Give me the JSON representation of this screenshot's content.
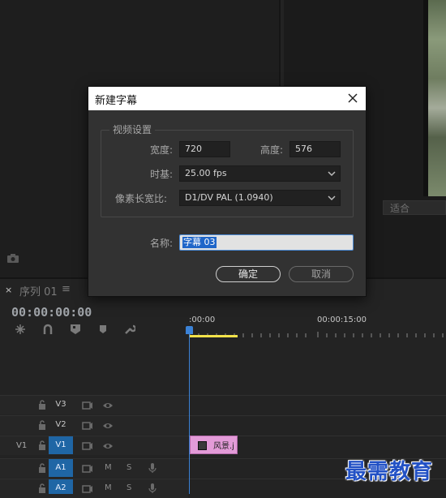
{
  "program_monitor": {
    "fit_select": "适合"
  },
  "sequence": {
    "tab_label": "序列 01",
    "close_glyph": "×",
    "menu_glyph": "≡",
    "timecode": "00:00:00:00"
  },
  "ruler": {
    "start": ":00:00",
    "mid": "00:00:15:00"
  },
  "tracks": [
    {
      "source": "",
      "name": "V3",
      "active": false,
      "type": "video"
    },
    {
      "source": "",
      "name": "V2",
      "active": false,
      "type": "video"
    },
    {
      "source": "V1",
      "name": "V1",
      "active": true,
      "type": "video"
    },
    {
      "source": "",
      "name": "A1",
      "active": true,
      "type": "audio",
      "m": "M",
      "s": "S"
    },
    {
      "source": "",
      "name": "A2",
      "active": true,
      "type": "audio",
      "m": "M",
      "s": "S"
    }
  ],
  "clip": {
    "label": "风景.j"
  },
  "watermark": "最需教育",
  "dialog": {
    "title": "新建字幕",
    "group_title": "视频设置",
    "width_label": "宽度:",
    "width_value": "720",
    "height_label": "高度:",
    "height_value": "576",
    "timebase_label": "时基:",
    "timebase_value": "25.00 fps",
    "pixel_aspect_label": "像素长宽比:",
    "pixel_aspect_value": "D1/DV PAL (1.0940)",
    "name_label": "名称:",
    "name_value": "字幕 03",
    "ok_label": "确定",
    "cancel_label": "取消"
  },
  "colors": {
    "accent_blue": "#1f66a5",
    "clip_pink": "#e39bd8",
    "work_area_yellow": "#f2e24a",
    "playhead": "#3b82d6"
  }
}
